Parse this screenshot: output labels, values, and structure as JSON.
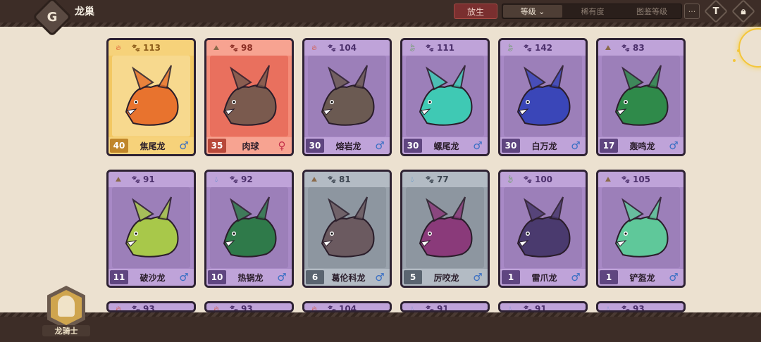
{
  "header": {
    "title": "龙巢",
    "back_icon": "back-diamond-icon",
    "release_label": "放生",
    "sort_options": [
      {
        "label": "等级 ⌄",
        "active": true
      },
      {
        "label": "稀有度",
        "active": false
      },
      {
        "label": "图鉴等级",
        "active": false
      }
    ],
    "more_label": "···",
    "filter_icon": "filter-icon",
    "lock_icon": "lock-icon"
  },
  "footer": {
    "rider_label": "龙骑士",
    "rider_icon": "viking-helmet-icon"
  },
  "colors": {
    "fire": "#d94a2c",
    "earth": "#8a6a4a",
    "water": "#3a86c9",
    "leaf": "#4a9a3a",
    "male": "#3a6fc4",
    "female": "#c4304a"
  },
  "dragons": [
    {
      "name": "焦尾龙",
      "level": "113",
      "count": "40",
      "gender": "♂",
      "element": "fire",
      "theme": "gold",
      "art_color": "#e8732e"
    },
    {
      "name": "肉球",
      "level": "98",
      "count": "35",
      "gender": "♀",
      "element": "earth",
      "theme": "red",
      "art_color": "#7a5a4e"
    },
    {
      "name": "熔岩龙",
      "level": "104",
      "count": "30",
      "gender": "♂",
      "element": "fire",
      "theme": "purple",
      "art_color": "#6b5a52"
    },
    {
      "name": "螺尾龙",
      "level": "111",
      "count": "30",
      "gender": "♂",
      "element": "leaf",
      "theme": "purple",
      "art_color": "#3fc9b4"
    },
    {
      "name": "白万龙",
      "level": "142",
      "count": "30",
      "gender": "♂",
      "element": "leaf",
      "theme": "purple",
      "art_color": "#3a46b8"
    },
    {
      "name": "轰鸣龙",
      "level": "83",
      "count": "17",
      "gender": "♂",
      "element": "earth",
      "theme": "purple",
      "art_color": "#2f8a4a"
    },
    {
      "name": "破沙龙",
      "level": "91",
      "count": "11",
      "gender": "♂",
      "element": "earth",
      "theme": "purple",
      "art_color": "#a8c84a"
    },
    {
      "name": "热锅龙",
      "level": "92",
      "count": "10",
      "gender": "♂",
      "element": "water",
      "theme": "purple",
      "art_color": "#2f7a4a"
    },
    {
      "name": "葛伦科龙",
      "level": "81",
      "count": "6",
      "gender": "♂",
      "element": "earth",
      "theme": "gray",
      "art_color": "#6b5a60"
    },
    {
      "name": "厉咬龙",
      "level": "77",
      "count": "5",
      "gender": "♂",
      "element": "water",
      "theme": "gray",
      "art_color": "#8a3a7a"
    },
    {
      "name": "雷爪龙",
      "level": "100",
      "count": "1",
      "gender": "♂",
      "element": "leaf",
      "theme": "purple",
      "art_color": "#4a3a6e"
    },
    {
      "name": "铲盔龙",
      "level": "105",
      "count": "1",
      "gender": "♂",
      "element": "earth",
      "theme": "purple",
      "art_color": "#5fc89a"
    }
  ],
  "next_row": [
    {
      "level": "93",
      "element": "fire",
      "theme": "purple"
    },
    {
      "level": "93",
      "element": "fire",
      "theme": "purple"
    },
    {
      "level": "104",
      "element": "fire",
      "theme": "purple"
    },
    {
      "level": "91",
      "element": "water",
      "theme": "purple"
    },
    {
      "level": "91",
      "element": "water",
      "theme": "purple"
    },
    {
      "level": "93",
      "element": "water",
      "theme": "purple"
    }
  ]
}
